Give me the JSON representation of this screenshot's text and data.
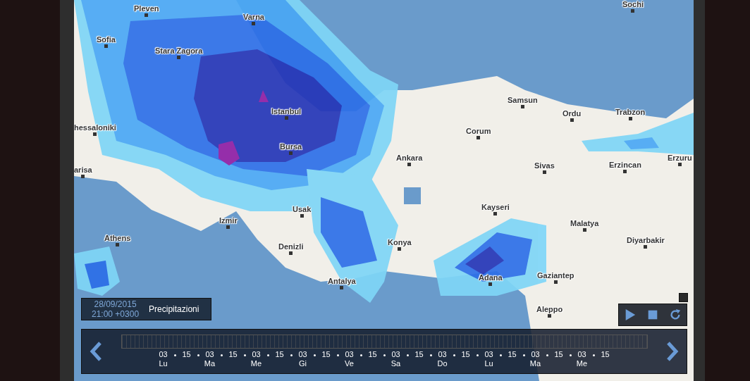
{
  "map": {
    "cities": [
      {
        "name": "Sochi"
      },
      {
        "name": "Pleven"
      },
      {
        "name": "Varna"
      },
      {
        "name": "Sofia"
      },
      {
        "name": "Stara Zagora"
      },
      {
        "name": "Istanbul"
      },
      {
        "name": "hessaloniki"
      },
      {
        "name": "Bursa"
      },
      {
        "name": "arisa"
      },
      {
        "name": "Samsun"
      },
      {
        "name": "Ordu"
      },
      {
        "name": "Trabzon"
      },
      {
        "name": "Corum"
      },
      {
        "name": "Ankara"
      },
      {
        "name": "Sivas"
      },
      {
        "name": "Erzincan"
      },
      {
        "name": "Erzuru"
      },
      {
        "name": "Usak"
      },
      {
        "name": "Izmir"
      },
      {
        "name": "Kayseri"
      },
      {
        "name": "Malatya"
      },
      {
        "name": "Athens"
      },
      {
        "name": "Diyarbakir"
      },
      {
        "name": "Denizli"
      },
      {
        "name": "Konya"
      },
      {
        "name": "Adana"
      },
      {
        "name": "Gaziantep"
      },
      {
        "name": "Antalya"
      },
      {
        "name": "Aleppo"
      }
    ]
  },
  "info": {
    "date": "28/09/2015",
    "time": "21:00 +0300",
    "layer": "Precipitazioni"
  },
  "timeline": {
    "ticks": [
      {
        "hour": "03",
        "day": "Lu"
      },
      {
        "hour": "15"
      },
      {
        "hour": "03",
        "day": "Ma"
      },
      {
        "hour": "15"
      },
      {
        "hour": "03",
        "day": "Me"
      },
      {
        "hour": "15"
      },
      {
        "hour": "03",
        "day": "Gi"
      },
      {
        "hour": "15"
      },
      {
        "hour": "03",
        "day": "Ve"
      },
      {
        "hour": "15"
      },
      {
        "hour": "03",
        "day": "Sa"
      },
      {
        "hour": "15"
      },
      {
        "hour": "03",
        "day": "Do"
      },
      {
        "hour": "15"
      },
      {
        "hour": "03",
        "day": "Lu"
      },
      {
        "hour": "15"
      },
      {
        "hour": "03",
        "day": "Ma"
      },
      {
        "hour": "15"
      },
      {
        "hour": "03",
        "day": "Me"
      },
      {
        "hour": "15"
      }
    ]
  }
}
